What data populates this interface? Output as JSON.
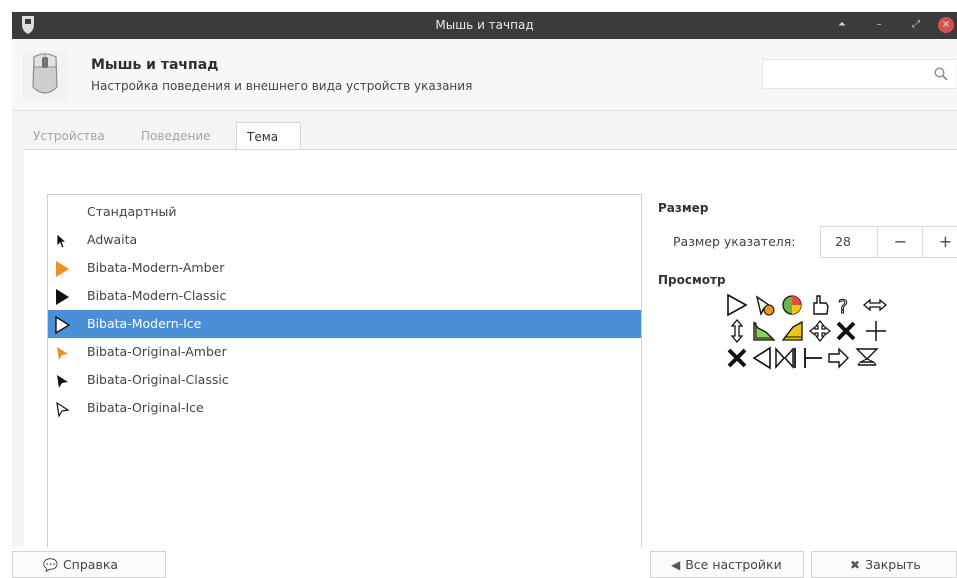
{
  "window": {
    "title": "Мышь и тачпад",
    "controls": [
      "shade",
      "minimize",
      "maximize",
      "close"
    ]
  },
  "header": {
    "title": "Мышь и тачпад",
    "subtitle": "Настройка поведения и внешнего вида устройств указания",
    "search_placeholder": ""
  },
  "tabs": [
    {
      "label": "Устройства",
      "active": false
    },
    {
      "label": "Поведение",
      "active": false
    },
    {
      "label": "Тема",
      "active": true
    }
  ],
  "themes": [
    {
      "name": "Стандартный",
      "cursor": "none",
      "selected": false
    },
    {
      "name": "Adwaita",
      "cursor": "adwaita-arrow-icon",
      "selected": false
    },
    {
      "name": "Bibata-Modern-Amber",
      "cursor": "amber-arrow-icon",
      "selected": false
    },
    {
      "name": "Bibata-Modern-Classic",
      "cursor": "black-arrow-icon",
      "selected": false
    },
    {
      "name": "Bibata-Modern-Ice",
      "cursor": "white-arrow-icon",
      "selected": true
    },
    {
      "name": "Bibata-Original-Amber",
      "cursor": "amber-arrow-icon",
      "selected": false
    },
    {
      "name": "Bibata-Original-Classic",
      "cursor": "black-arrow-icon",
      "selected": false
    },
    {
      "name": "Bibata-Original-Ice",
      "cursor": "white-arrow-icon",
      "selected": false
    }
  ],
  "size_section": {
    "title": "Размер",
    "label": "Размер указателя:",
    "value": "28",
    "minus": "−",
    "plus": "+"
  },
  "preview_section": {
    "title": "Просмотр",
    "cursors": [
      "arrow-icon",
      "wait-icon",
      "busy-icon",
      "hand-icon",
      "help-icon",
      "resize-horizontal-icon",
      "resize-vertical-icon",
      "corner-resize-icon",
      "corner-resize-filled-icon",
      "move-icon",
      "cross-icon",
      "plus-icon",
      "forbidden-icon",
      "left-arrow-icon",
      "split-icon",
      "text-bar-icon",
      "right-arrow-icon",
      "hourglass-icon"
    ]
  },
  "footer": {
    "help": "Справка",
    "all_settings": "Все настройки",
    "close": "Закрыть"
  },
  "colors": {
    "selection": "#4a90d9",
    "titlebar": "#3b3b3b",
    "close_button": "#d9504f",
    "amber": "#f0901e"
  }
}
